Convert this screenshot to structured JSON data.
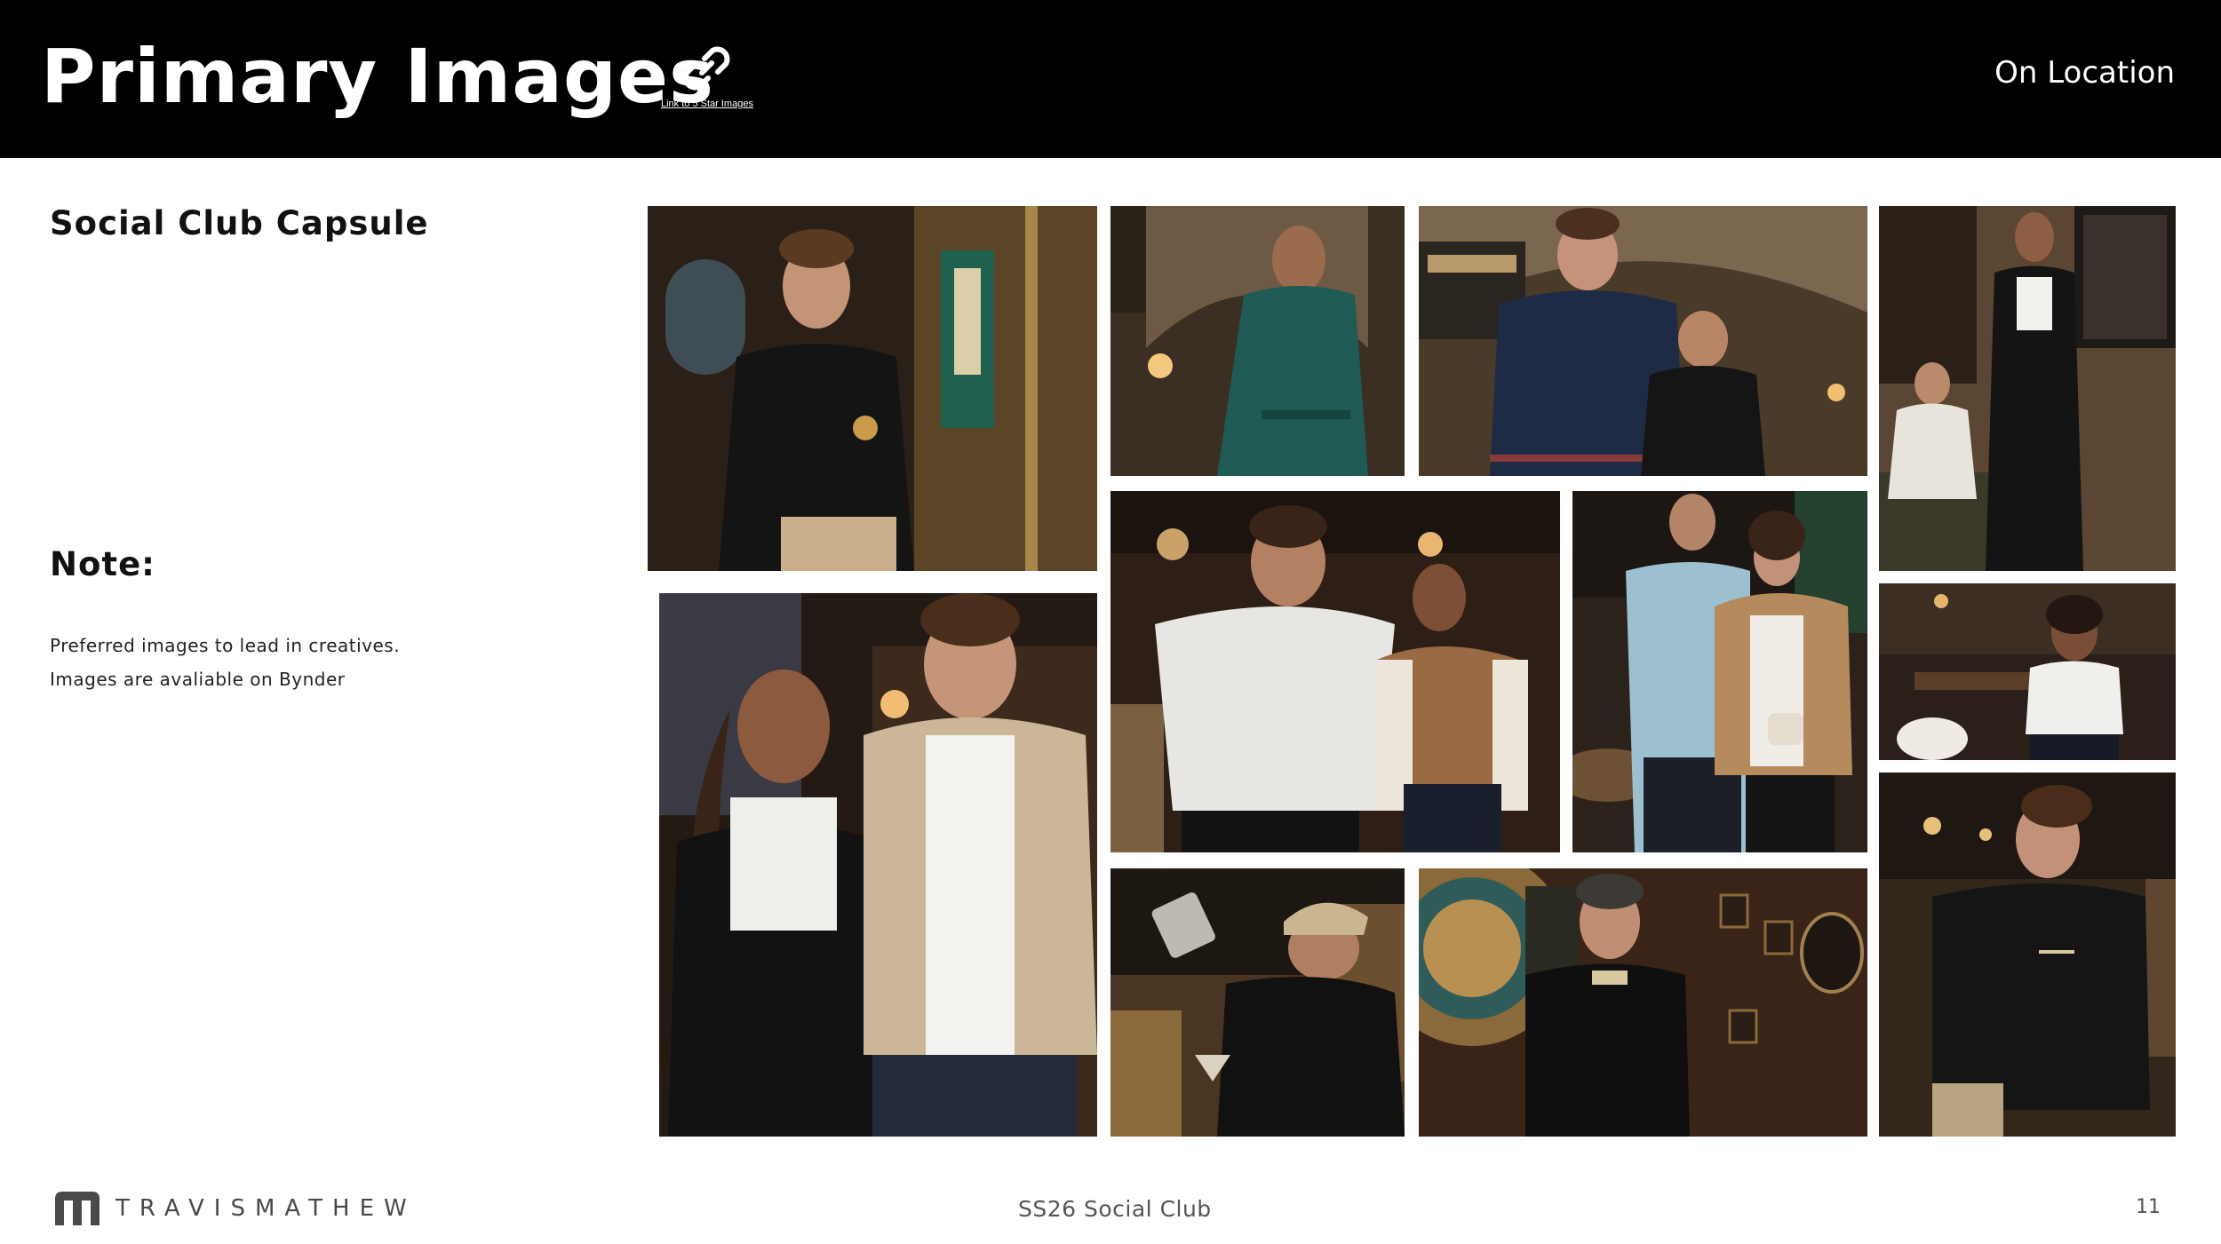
{
  "header": {
    "title": "Primary Images",
    "link_caption": "Link to 5 Star Images",
    "link_icon": "link-icon",
    "location": "On Location",
    "background": "#000000",
    "text_color": "#ffffff"
  },
  "sidebar": {
    "capsule_title": "Social Club Capsule",
    "note_heading": "Note:",
    "note_lines": [
      "Preferred images to lead in creatives.",
      "Images are avaliable on Bynder"
    ]
  },
  "gallery": {
    "photos": [
      {
        "name": "photo-man-black-shirt-holding-drink",
        "bg": "#2a2018",
        "accent": "#8c6a3f"
      },
      {
        "name": "photo-woman-green-knit-set",
        "bg": "#3b2e22",
        "accent": "#1f5a55"
      },
      {
        "name": "photo-man-navy-sweater-scoreboard",
        "bg": "#4a3a2a",
        "accent": "#1e2b45"
      },
      {
        "name": "photo-woman-black-jacket-standing",
        "bg": "#5a4632",
        "accent": "#141414"
      },
      {
        "name": "photo-couple-black-and-tan-cardigans",
        "bg": "#241a14",
        "accent": "#cbb797"
      },
      {
        "name": "photo-man-white-polo-woman-varsity-jacket",
        "bg": "#2e1f16",
        "accent": "#e8e6e2"
      },
      {
        "name": "photo-couple-blue-shirt-camel-jacket",
        "bg": "#2b231b",
        "accent": "#9cc0cf"
      },
      {
        "name": "photo-woman-white-tank-top",
        "bg": "#2a2019",
        "accent": "#f0efec"
      },
      {
        "name": "photo-bartender-pouring-cocktail",
        "bg": "#1d1712",
        "accent": "#c9b58f"
      },
      {
        "name": "photo-man-black-polo-dartboard",
        "bg": "#3a2418",
        "accent": "#0f0f10"
      },
      {
        "name": "photo-man-black-tee-bar",
        "bg": "#33271c",
        "accent": "#151515"
      }
    ]
  },
  "footer": {
    "brand": "TRAVISMATHEW",
    "logo_icon": "travismathew-logo-icon",
    "collection": "SS26 Social Club",
    "page_number": "11",
    "brand_color": "#4a4a4a"
  }
}
